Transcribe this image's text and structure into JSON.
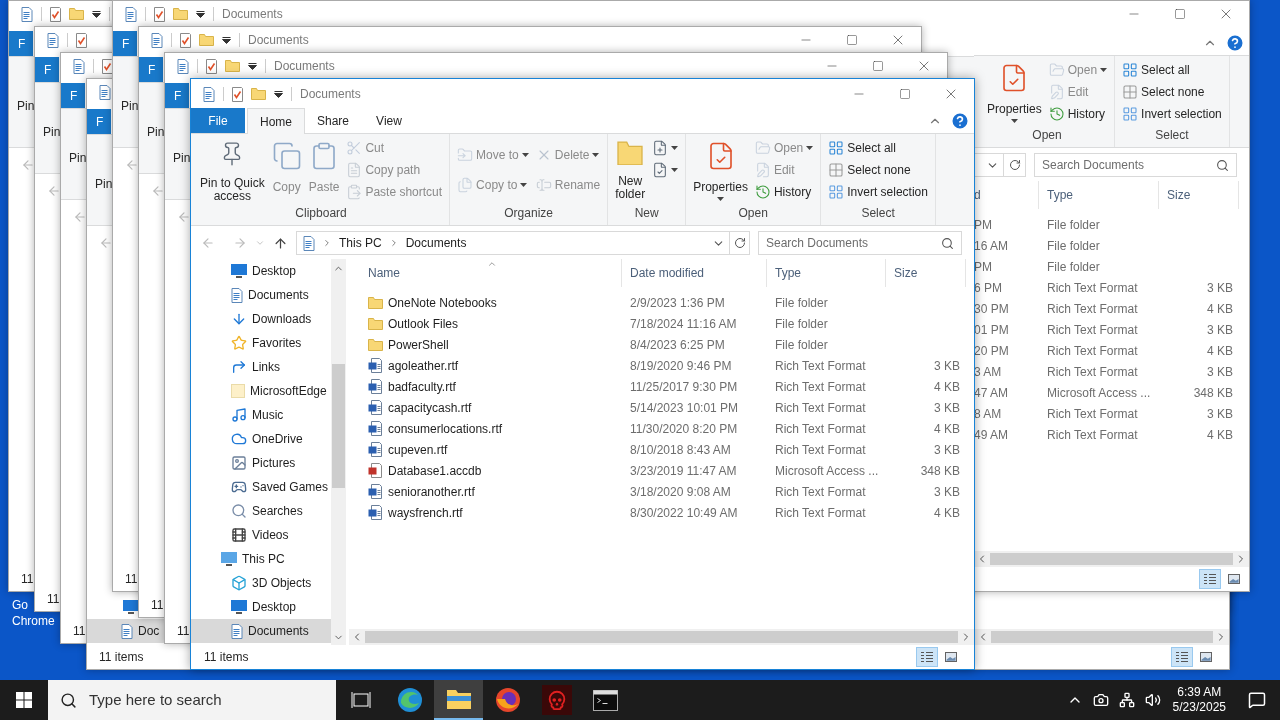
{
  "desktop_icon": {
    "label_lines": [
      "Go",
      "Chrome"
    ]
  },
  "back_windows": [
    {
      "file_tab": "F",
      "ribbon_text": "Pin",
      "status": "11"
    },
    {
      "file_tab": "F",
      "ribbon_text": "Pin",
      "status": "11"
    },
    {
      "file_tab": "F",
      "ribbon_text": "Pin",
      "status": "11"
    },
    {
      "file_tab": "F",
      "ribbon_text": "Pin",
      "status": "11 items",
      "bottom_bar": true,
      "nav_items": [
        {
          "kind": "desktop",
          "selected": false
        },
        {
          "kind": "documents",
          "label": "Doc",
          "selected": true
        }
      ]
    },
    {
      "title": "Documents",
      "file_tab": "F",
      "ribbon_text": "Pin",
      "status": "11",
      "strip": {
        "groups": [
          {
            "label": "Open",
            "columns": [
              [
                {
                  "label": "Properties",
                  "kind": "properties",
                  "large": true,
                  "menu": true,
                  "disabled": false
                }
              ],
              [
                {
                  "label": "Open",
                  "kind": "open",
                  "large": false,
                  "menu": true,
                  "disabled": true
                },
                {
                  "label": "Edit",
                  "kind": "edit",
                  "large": false,
                  "menu": false,
                  "disabled": true
                },
                {
                  "label": "History",
                  "kind": "history",
                  "large": false,
                  "menu": false,
                  "disabled": false
                }
              ]
            ]
          },
          {
            "label": "Select",
            "columns": [
              [
                {
                  "label": "Select all",
                  "kind": "selectall",
                  "large": false,
                  "menu": false,
                  "disabled": false
                },
                {
                  "label": "Select none",
                  "kind": "selectnone",
                  "large": false,
                  "menu": false,
                  "disabled": false
                },
                {
                  "label": "Invert selection",
                  "kind": "invert",
                  "large": false,
                  "menu": false,
                  "disabled": false
                }
              ]
            ]
          }
        ],
        "search": {
          "placeholder": "Search Documents"
        },
        "columns": [
          "d",
          "Type",
          "Size"
        ],
        "rows": [
          {
            "date": "PM",
            "type": "File folder"
          },
          {
            "date": "16 AM",
            "type": "File folder"
          },
          {
            "date": "PM",
            "type": "File folder"
          },
          {
            "date": "6 PM",
            "type": "Rich Text Format",
            "size": "3 KB"
          },
          {
            "date": "30 PM",
            "type": "Rich Text Format",
            "size": "4 KB"
          },
          {
            "date": "01 PM",
            "type": "Rich Text Format",
            "size": "3 KB"
          },
          {
            "date": "20 PM",
            "type": "Rich Text Format",
            "size": "4 KB"
          },
          {
            "date": "3 AM",
            "type": "Rich Text Format",
            "size": "3 KB"
          },
          {
            "date": "47 AM",
            "type": "Microsoft Access ...",
            "size": "348 KB"
          },
          {
            "date": "8 AM",
            "type": "Rich Text Format",
            "size": "3 KB"
          },
          {
            "date": "49 AM",
            "type": "Rich Text Format",
            "size": "4 KB"
          }
        ]
      }
    },
    {
      "title": "Documents",
      "file_tab": "F",
      "ribbon_text": "Pin",
      "status": "11"
    },
    {
      "title": "Documents",
      "file_tab": "F",
      "ribbon_text": "Pin",
      "status": "11"
    }
  ],
  "window": {
    "title": "Documents",
    "tabs": [
      {
        "label": "File",
        "kind": "file",
        "selected": false
      },
      {
        "label": "Home",
        "kind": "tab",
        "selected": true
      },
      {
        "label": "Share",
        "kind": "tab",
        "selected": false
      },
      {
        "label": "View",
        "kind": "tab",
        "selected": false
      }
    ],
    "ribbon": [
      {
        "label": "Clipboard",
        "columns": [
          [
            {
              "label": "Pin to Quick\naccess",
              "kind": "pin",
              "large": true,
              "menu": false,
              "disabled": false
            }
          ],
          [
            {
              "label": "Copy",
              "kind": "copy",
              "large": true,
              "menu": false,
              "disabled": true
            }
          ],
          [
            {
              "label": "Paste",
              "kind": "paste",
              "large": true,
              "menu": false,
              "disabled": true
            }
          ],
          [
            {
              "label": "Cut",
              "kind": "cut",
              "large": false,
              "menu": false,
              "disabled": true
            },
            {
              "label": "Copy path",
              "kind": "path",
              "large": false,
              "menu": false,
              "disabled": true
            },
            {
              "label": "Paste shortcut",
              "kind": "shortcut",
              "large": false,
              "menu": false,
              "disabled": true
            }
          ]
        ]
      },
      {
        "label": "Organize",
        "columns": [
          [
            {
              "label": "Move to",
              "kind": "move",
              "large": false,
              "menu": true,
              "disabled": true
            },
            {
              "label": "Copy to",
              "kind": "copyto",
              "large": false,
              "menu": true,
              "disabled": true
            }
          ],
          [
            {
              "label": "Delete",
              "kind": "delete",
              "large": false,
              "menu": true,
              "disabled": true
            },
            {
              "label": "Rename",
              "kind": "rename",
              "large": false,
              "menu": false,
              "disabled": true
            }
          ]
        ]
      },
      {
        "label": "New",
        "columns": [
          [
            {
              "label": "New\nfolder",
              "kind": "folder",
              "large": true,
              "menu": false,
              "disabled": false
            }
          ],
          [
            {
              "kind": "newitem",
              "large": false,
              "menu": true,
              "disabled": false
            },
            {
              "kind": "access",
              "large": false,
              "menu": true,
              "disabled": false
            }
          ]
        ]
      },
      {
        "label": "Open",
        "columns": [
          [
            {
              "label": "Properties",
              "kind": "properties",
              "large": true,
              "menu": true,
              "disabled": false
            }
          ],
          [
            {
              "label": "Open",
              "kind": "open",
              "large": false,
              "menu": true,
              "disabled": true
            },
            {
              "label": "Edit",
              "kind": "edit",
              "large": false,
              "menu": false,
              "disabled": true
            },
            {
              "label": "History",
              "kind": "history",
              "large": false,
              "menu": false,
              "disabled": false
            }
          ]
        ]
      },
      {
        "label": "Select",
        "columns": [
          [
            {
              "label": "Select all",
              "kind": "selectall",
              "large": false,
              "menu": false,
              "disabled": false
            },
            {
              "label": "Select none",
              "kind": "selectnone",
              "large": false,
              "menu": false,
              "disabled": false
            },
            {
              "label": "Invert selection",
              "kind": "invert",
              "large": false,
              "menu": false,
              "disabled": false
            }
          ]
        ]
      }
    ],
    "address": {
      "crumbs": [
        "This PC",
        "Documents"
      ]
    },
    "search": {
      "placeholder": "Search Documents"
    },
    "nav_items": [
      {
        "label": "Desktop",
        "kind": "desktop",
        "selected": false
      },
      {
        "label": "Documents",
        "kind": "documents",
        "selected": false
      },
      {
        "label": "Downloads",
        "kind": "downloads",
        "selected": false
      },
      {
        "label": "Favorites",
        "kind": "favorites",
        "selected": false
      },
      {
        "label": "Links",
        "kind": "links",
        "selected": false
      },
      {
        "label": "MicrosoftEdge",
        "kind": "folder",
        "selected": false
      },
      {
        "label": "Music",
        "kind": "music",
        "selected": false
      },
      {
        "label": "OneDrive",
        "kind": "onedrive",
        "selected": false
      },
      {
        "label": "Pictures",
        "kind": "pictures",
        "selected": false
      },
      {
        "label": "Saved Games",
        "kind": "games",
        "selected": false
      },
      {
        "label": "Searches",
        "kind": "searches",
        "selected": false
      },
      {
        "label": "Videos",
        "kind": "videos",
        "selected": false
      },
      {
        "label": "This PC",
        "kind": "thispc",
        "selected": false,
        "children": [
          {
            "label": "3D Objects",
            "kind": "objects",
            "selected": false
          },
          {
            "label": "Desktop",
            "kind": "desktop",
            "selected": false
          },
          {
            "label": "Documents",
            "kind": "documents",
            "selected": true
          }
        ]
      }
    ],
    "columns": [
      "Name",
      "Date modified",
      "Type",
      "Size"
    ],
    "files": [
      {
        "name": "OneNote Notebooks",
        "kind": "folder",
        "date": "2/9/2023 1:36 PM",
        "type": "File folder"
      },
      {
        "name": "Outlook Files",
        "kind": "folder",
        "date": "7/18/2024 11:16 AM",
        "type": "File folder"
      },
      {
        "name": "PowerShell",
        "kind": "folder",
        "date": "8/4/2023 6:25 PM",
        "type": "File folder"
      },
      {
        "name": "agoleather.rtf",
        "kind": "rtf",
        "date": "8/19/2020 9:46 PM",
        "type": "Rich Text Format",
        "size": "3 KB"
      },
      {
        "name": "badfaculty.rtf",
        "kind": "rtf",
        "date": "11/25/2017 9:30 PM",
        "type": "Rich Text Format",
        "size": "4 KB"
      },
      {
        "name": "capacitycash.rtf",
        "kind": "rtf",
        "date": "5/14/2023 10:01 PM",
        "type": "Rich Text Format",
        "size": "3 KB"
      },
      {
        "name": "consumerlocations.rtf",
        "kind": "rtf",
        "date": "11/30/2020 8:20 PM",
        "type": "Rich Text Format",
        "size": "4 KB"
      },
      {
        "name": "cupeven.rtf",
        "kind": "rtf",
        "date": "8/10/2018 8:43 AM",
        "type": "Rich Text Format",
        "size": "3 KB"
      },
      {
        "name": "Database1.accdb",
        "kind": "access",
        "date": "3/23/2019 11:47 AM",
        "type": "Microsoft Access ...",
        "size": "348 KB"
      },
      {
        "name": "senioranother.rtf",
        "kind": "rtf",
        "date": "3/18/2020 9:08 AM",
        "type": "Rich Text Format",
        "size": "3 KB"
      },
      {
        "name": "waysfrench.rtf",
        "kind": "rtf",
        "date": "8/30/2022 10:49 AM",
        "type": "Rich Text Format",
        "size": "4 KB"
      }
    ],
    "status": "11 items"
  },
  "taskbar": {
    "search": {
      "placeholder": "Type here to search"
    },
    "apps": [
      {
        "kind": "taskview",
        "selected": false
      },
      {
        "kind": "edge",
        "selected": false
      },
      {
        "kind": "explorer",
        "selected": true
      },
      {
        "kind": "firefox",
        "selected": false
      },
      {
        "kind": "skull",
        "selected": false
      },
      {
        "kind": "terminal",
        "selected": false
      }
    ],
    "time": "6:39 AM",
    "date": "5/23/2025"
  }
}
